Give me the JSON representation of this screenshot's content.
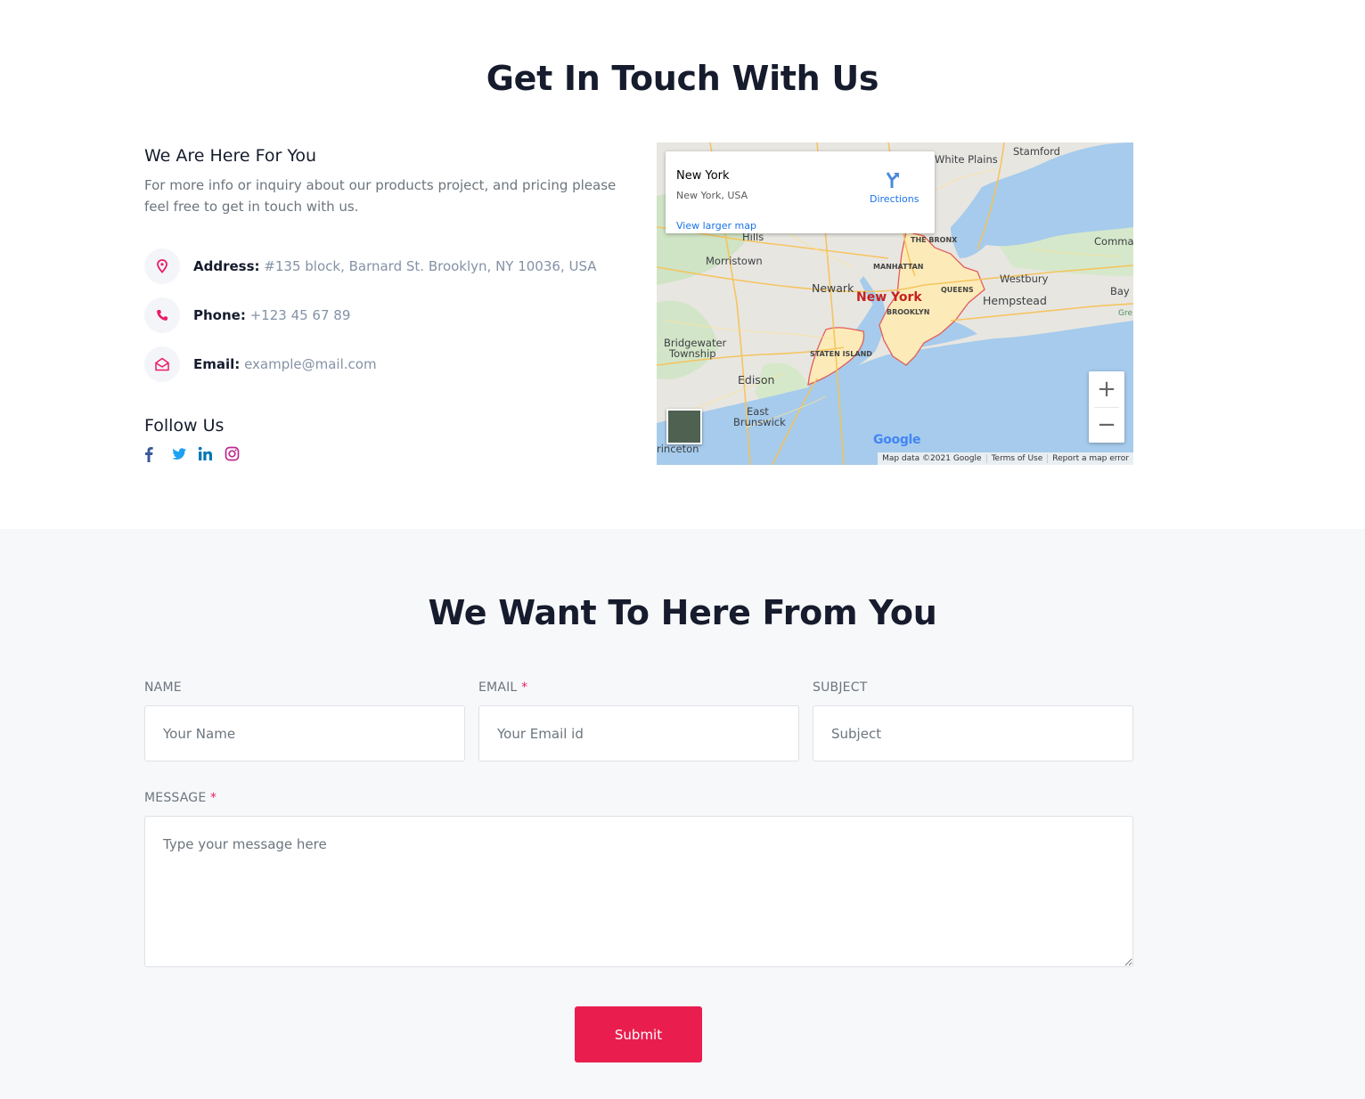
{
  "contact": {
    "title": "Get In Touch With Us",
    "subtitle": "We Are Here For You",
    "description": "For more info or inquiry about our products project, and pricing please feel free to get in touch with us.",
    "address_label": "Address:",
    "address_value": "#135 block, Barnard St. Brooklyn, NY 10036, USA",
    "phone_label": "Phone:",
    "phone_value": "+123 45 67 89",
    "email_label": "Email:",
    "email_value": "example@mail.com",
    "follow_title": "Follow Us",
    "socials": [
      "facebook-icon",
      "twitter-icon",
      "linkedin-icon",
      "instagram-icon"
    ],
    "accent_color": "#e91e63"
  },
  "map": {
    "place_name": "New York",
    "place_address": "New York, USA",
    "directions_label": "Directions",
    "view_larger_label": "View larger map",
    "zoom_in": "+",
    "zoom_out": "−",
    "google_logo": "Google",
    "attribution": [
      "Map data ©2021 Google",
      "Terms of Use",
      "Report a map error"
    ],
    "labels": {
      "white_plains": "White Plains",
      "stamford": "Stamford",
      "hills": "Hills",
      "morristown": "Morristown",
      "the_bronx": "THE BRONX",
      "manhattan": "MANHATTAN",
      "newark": "Newark",
      "new_york": "New York",
      "queens": "QUEENS",
      "brooklyn": "BROOKLYN",
      "westbury": "Westbury",
      "hempstead": "Hempstead",
      "commack": "Commac",
      "bay_shore": "Bay S",
      "bridgewater": "Bridgewater",
      "township": "Township",
      "staten_island": "STATEN ISLAND",
      "edison": "Edison",
      "east_brunswick_1": "East",
      "east_brunswick_2": "Brunswick",
      "princeton": "rinceton",
      "gre": "Gre"
    }
  },
  "form": {
    "title": "We Want To Here From You",
    "name_label": "NAME",
    "name_placeholder": "Your Name",
    "email_label": "EMAIL",
    "email_placeholder": "Your Email id",
    "subject_label": "SUBJECT",
    "subject_placeholder": "Subject",
    "message_label": "MESSAGE",
    "message_placeholder": "Type your message here",
    "required_mark": "*",
    "submit_label": "Submit",
    "submit_color": "#e91e4f",
    "section_background": "#f7f8fa"
  }
}
